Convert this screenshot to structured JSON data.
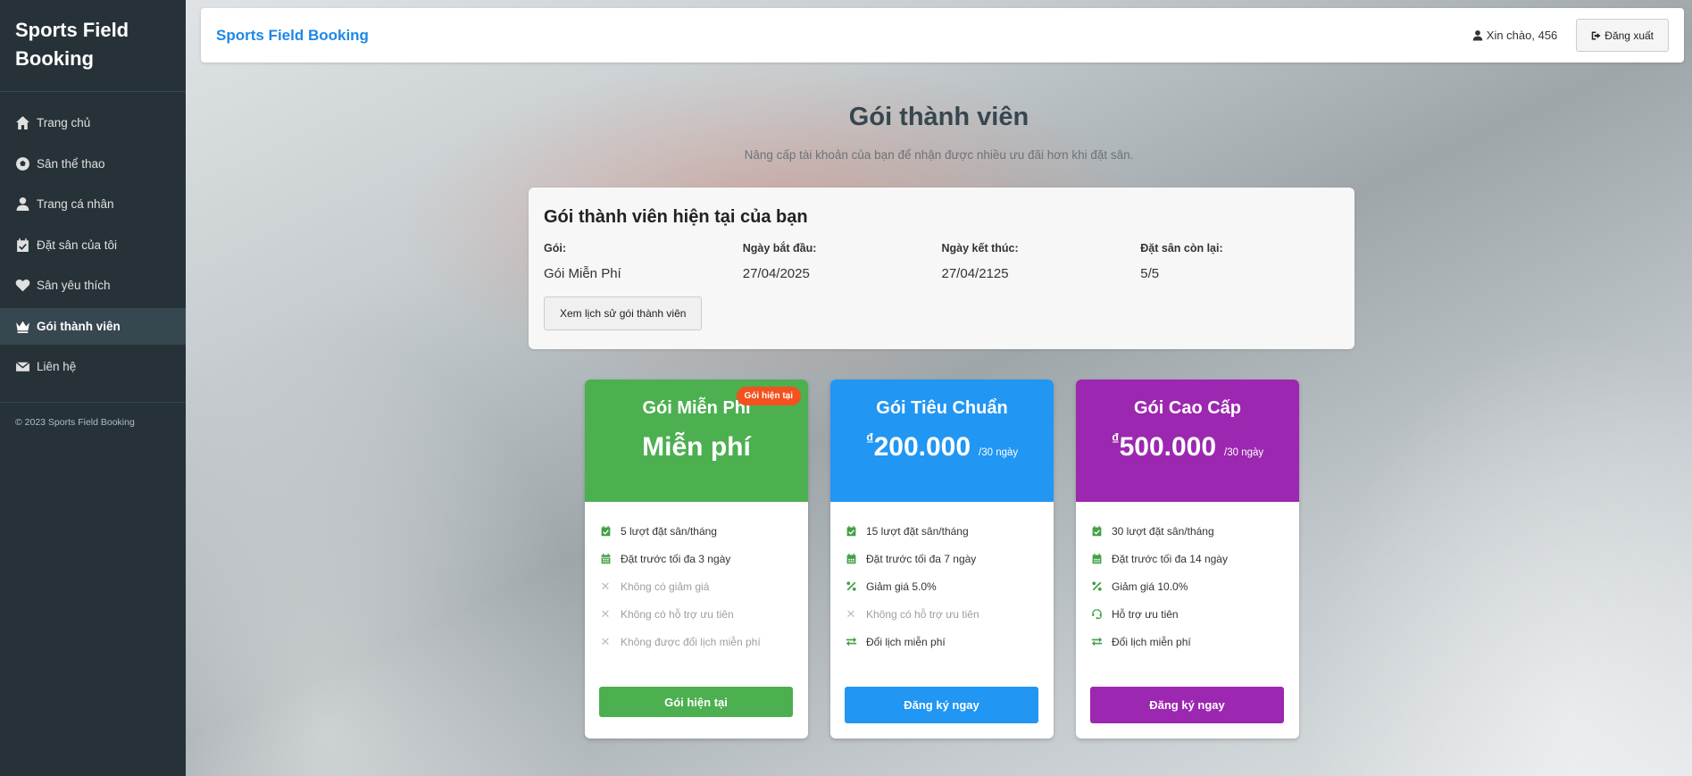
{
  "sidebar": {
    "brand_line1": "Sports Field",
    "brand_line2": "Booking",
    "items": [
      {
        "label": "Trang chủ"
      },
      {
        "label": "Sân thể thao"
      },
      {
        "label": "Trang cá nhân"
      },
      {
        "label": "Đặt sân của tôi"
      },
      {
        "label": "Sân yêu thích"
      },
      {
        "label": "Gói thành viên"
      },
      {
        "label": "Liên hệ"
      }
    ],
    "copyright": "© 2023 Sports Field Booking"
  },
  "topbar": {
    "brand": "Sports Field Booking",
    "greeting": "Xin chào, 456",
    "logout_label": "Đăng xuất"
  },
  "page": {
    "title": "Gói thành viên",
    "subtitle": "Nâng cấp tài khoản của bạn để nhận được nhiều ưu đãi hơn khi đặt sân."
  },
  "current": {
    "heading": "Gói thành viên hiện tại của bạn",
    "plan_label": "Gói:",
    "plan_value": "Gói Miễn Phí",
    "start_label": "Ngày bắt đầu:",
    "start_value": "27/04/2025",
    "end_label": "Ngày kết thúc:",
    "end_value": "27/04/2125",
    "remaining_label": "Đặt sân còn lại:",
    "remaining_value": "5/5",
    "history_button": "Xem lịch sử gói thành viên"
  },
  "plans": [
    {
      "name": "Gói Miễn Phí",
      "price": "Miễn phí",
      "badge": "Gói hiện tại",
      "features": [
        "5 lượt đặt sân/tháng",
        "Đặt trước tối đa 3 ngày",
        "Không có giảm giá",
        "Không có hỗ trợ ưu tiên",
        "Không được đổi lịch miễn phí"
      ],
      "button": "Gói hiện tại",
      "color": "#4caf50"
    },
    {
      "name": "Gói Tiêu Chuẩn",
      "currency": "₫",
      "price": "200.000",
      "period": "/30 ngày",
      "features": [
        "15 lượt đặt sân/tháng",
        "Đặt trước tối đa 7 ngày",
        "Giảm giá 5.0%",
        "Không có hỗ trợ ưu tiên",
        "Đổi lịch miễn phí"
      ],
      "button": "Đăng ký ngay",
      "color": "#2196f3"
    },
    {
      "name": "Gói Cao Cấp",
      "currency": "₫",
      "price": "500.000",
      "period": "/30 ngày",
      "features": [
        "30 lượt đặt sân/tháng",
        "Đặt trước tối đa 14 ngày",
        "Giảm giá 10.0%",
        "Hỗ trợ ưu tiên",
        "Đổi lịch miễn phí"
      ],
      "button": "Đăng ký ngay",
      "color": "#9c27b0"
    }
  ]
}
